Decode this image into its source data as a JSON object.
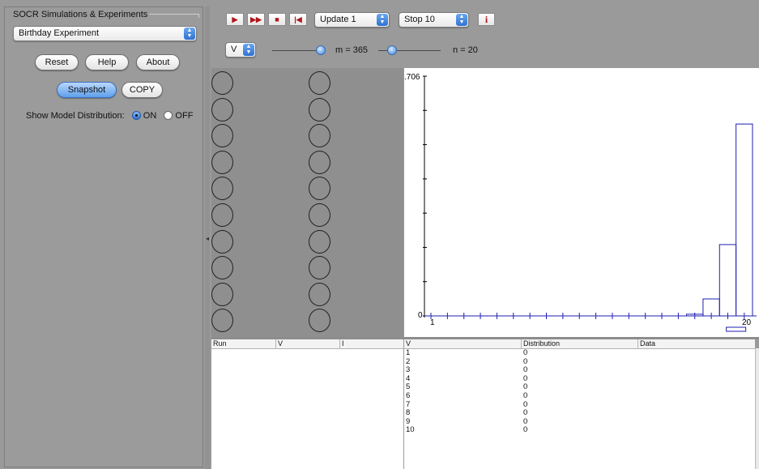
{
  "left_panel": {
    "group_title": "SOCR Simulations & Experiments",
    "experiment_select": "Birthday Experiment",
    "buttons": {
      "reset": "Reset",
      "help": "Help",
      "about": "About",
      "snapshot": "Snapshot",
      "copy": "COPY"
    },
    "model_distribution_label": "Show Model Distribution:",
    "on_label": "ON",
    "off_label": "OFF",
    "model_distribution": "ON"
  },
  "toolbar": {
    "step_icon": "play-icon",
    "run_icon": "fast-forward-icon",
    "stop_icon": "stop-icon",
    "reset_icon": "rewind-to-start-icon",
    "update_select": "Update 1",
    "stop_select": "Stop 10",
    "info_icon": "info-icon",
    "info_label": "i",
    "variable_select": "V",
    "m_label": "m = 365",
    "n_label": "n = 20",
    "m_value": 365,
    "n_value": 20
  },
  "chart_data": {
    "type": "bar",
    "y_top_label": ".706",
    "y_zero_label": "0",
    "x_start_label": "1",
    "x_end_label": "20",
    "xlim": [
      1,
      20
    ],
    "ylim": [
      0,
      0.706
    ],
    "series": [
      {
        "values": [
          0,
          0,
          0,
          0,
          0,
          0,
          0,
          0,
          0,
          0,
          0,
          0,
          0,
          0,
          0,
          0,
          0.005,
          0.05,
          0.21,
          0.565
        ]
      }
    ],
    "x_ticks": [
      1,
      2,
      3,
      4,
      5,
      6,
      7,
      8,
      9,
      10,
      11,
      12,
      13,
      14,
      15,
      16,
      17,
      18,
      19,
      20
    ],
    "y_tick_count": 8,
    "bar_color": "#1f1fb0"
  },
  "run_table": {
    "columns": [
      "Run",
      "V",
      "I"
    ],
    "rows": []
  },
  "dist_table": {
    "columns": [
      "V",
      "Distribution",
      "Data"
    ],
    "rows": [
      [
        "1",
        "0",
        ""
      ],
      [
        "2",
        "0",
        ""
      ],
      [
        "3",
        "0",
        ""
      ],
      [
        "4",
        "0",
        ""
      ],
      [
        "5",
        "0",
        ""
      ],
      [
        "6",
        "0",
        ""
      ],
      [
        "7",
        "0",
        ""
      ],
      [
        "8",
        "0",
        ""
      ],
      [
        "9",
        "0",
        ""
      ],
      [
        "10",
        "0",
        ""
      ]
    ]
  },
  "balls": {
    "count": 20,
    "columns": 2
  }
}
